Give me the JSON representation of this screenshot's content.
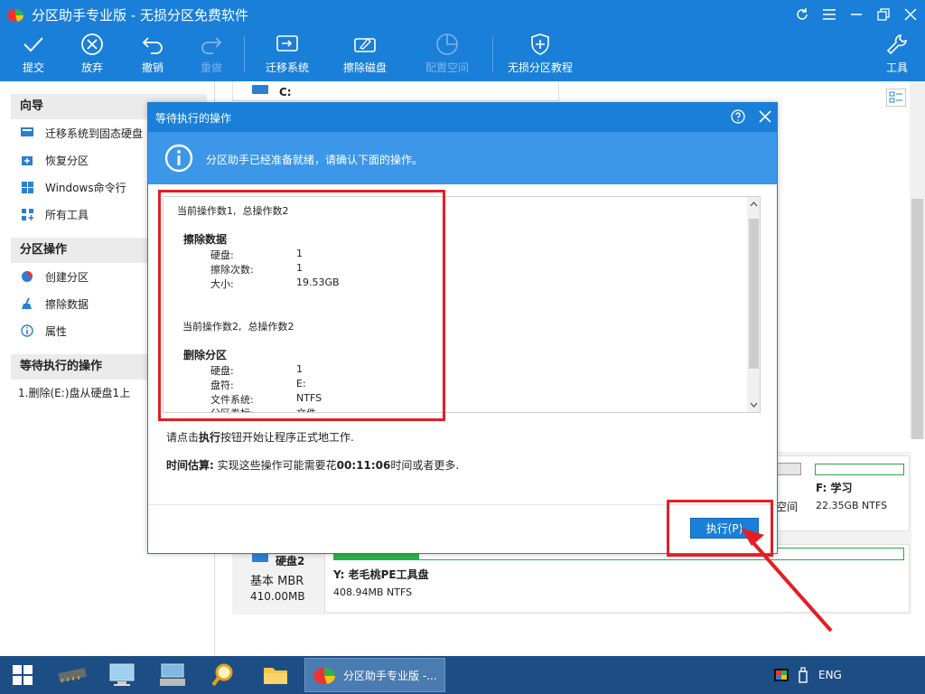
{
  "window": {
    "title": "分区助手专业版 - 无损分区免费软件"
  },
  "toolbar": {
    "items": [
      {
        "label": "提交",
        "icon": "check-icon",
        "enabled": true
      },
      {
        "label": "放弃",
        "icon": "cancel-circle-icon",
        "enabled": true
      },
      {
        "label": "撤销",
        "icon": "undo-icon",
        "enabled": true
      },
      {
        "label": "重做",
        "icon": "redo-icon",
        "enabled": false
      },
      {
        "label": "迁移系统",
        "icon": "migrate-os-icon",
        "enabled": true
      },
      {
        "label": "擦除磁盘",
        "icon": "wipe-disk-icon",
        "enabled": true
      },
      {
        "label": "配置空间",
        "icon": "allocate-space-icon",
        "enabled": false
      },
      {
        "label": "无损分区教程",
        "icon": "shield-icon",
        "enabled": true
      },
      {
        "label": "工具",
        "icon": "wrench-icon",
        "enabled": true
      }
    ]
  },
  "sidebar": {
    "wizard": {
      "title": "向导",
      "items": [
        {
          "label": "迁移系统到固态硬盘",
          "icon": "migrate-ssd-icon"
        },
        {
          "label": "恢复分区",
          "icon": "recover-partition-icon"
        },
        {
          "label": "Windows命令行",
          "icon": "windows-icon"
        },
        {
          "label": "所有工具",
          "icon": "all-tools-icon"
        }
      ]
    },
    "partition_ops": {
      "title": "分区操作",
      "items": [
        {
          "label": "创建分区",
          "icon": "create-partition-icon"
        },
        {
          "label": "擦除数据",
          "icon": "broom-icon"
        },
        {
          "label": "属性",
          "icon": "info-icon"
        }
      ]
    },
    "pending": {
      "title": "等待执行的操作",
      "items": [
        "1.删除(E:)盘从硬盘1上"
      ]
    }
  },
  "main": {
    "disk_c_label": "C:",
    "partition_g_tail": "空间",
    "partition_f": {
      "name": "F: 学习",
      "size": "22.35GB NTFS"
    },
    "disk2": {
      "name": "硬盘2",
      "type": "基本 MBR",
      "size": "410.00MB"
    },
    "partition_y": {
      "name": "Y: 老毛桃PE工具盘",
      "size": "408.94MB NTFS",
      "used_fraction": 0.15
    }
  },
  "dialog": {
    "title": "等待执行的操作",
    "banner_text": "分区助手已经准备就绪，请确认下面的操作。",
    "log": {
      "op1_header": "当前操作数1,  总操作数2",
      "op1_title": "擦除数据",
      "op1_fields": [
        {
          "key": "硬盘:",
          "value": "1"
        },
        {
          "key": "擦除次数:",
          "value": "1"
        },
        {
          "key": "大小:",
          "value": "19.53GB"
        }
      ],
      "op2_header": "当前操作数2,  总操作数2",
      "op2_title": "删除分区",
      "op2_fields": [
        {
          "key": "硬盘:",
          "value": "1"
        },
        {
          "key": "盘符:",
          "value": "E:"
        },
        {
          "key": "文件系统:",
          "value": "NTFS"
        },
        {
          "key": "分区卷标:",
          "value": "文件"
        }
      ]
    },
    "instruction_prefix": "请点击",
    "instruction_bold": "执行",
    "instruction_suffix": "按钮开始让程序正式地工作.",
    "estimate_label": "时间估算:",
    "estimate_prefix": " 实现这些操作可能需要花",
    "estimate_time": "00:11:06",
    "estimate_suffix": "时间或者更多.",
    "execute_button": "执行(P)"
  },
  "taskbar": {
    "active_app_label": "分区助手专业版 -...",
    "language": "ENG"
  },
  "colors": {
    "accent": "#1a7fd8",
    "banner": "#3c97e9",
    "annotation_red": "#e31e24",
    "partition_green": "#2bb44a",
    "taskbar": "#1d4d85"
  }
}
